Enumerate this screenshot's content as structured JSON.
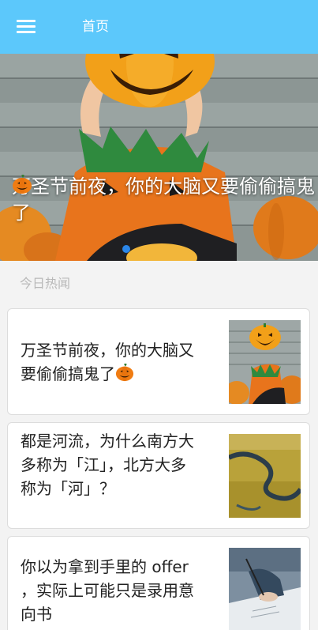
{
  "header": {
    "title": "首页",
    "menu_icon": "hamburger-menu-icon",
    "background": "#5cc8fb"
  },
  "banner": {
    "caption": "万圣节前夜，你的大脑又要偷偷搞鬼了",
    "caption_emoji": "jack-o-lantern-icon",
    "active_dot": 1,
    "dot_count": 2,
    "dot_active_color": "#2b86e9"
  },
  "section": {
    "label": "今日热闻"
  },
  "news": [
    {
      "title": "万圣节前夜，你的大脑又要偷偷搞鬼了",
      "emoji": "jack-o-lantern-icon",
      "thumb": "halloween-child-thumbnail"
    },
    {
      "title": "都是河流，为什么南方大多称为「江」，北方大多称为「河」？",
      "thumb": "meandering-river-aerial-thumbnail"
    },
    {
      "title": "你以为拿到手里的 offer ，实际上可能只是录用意向书",
      "thumb": "hand-signing-document-thumbnail"
    }
  ]
}
